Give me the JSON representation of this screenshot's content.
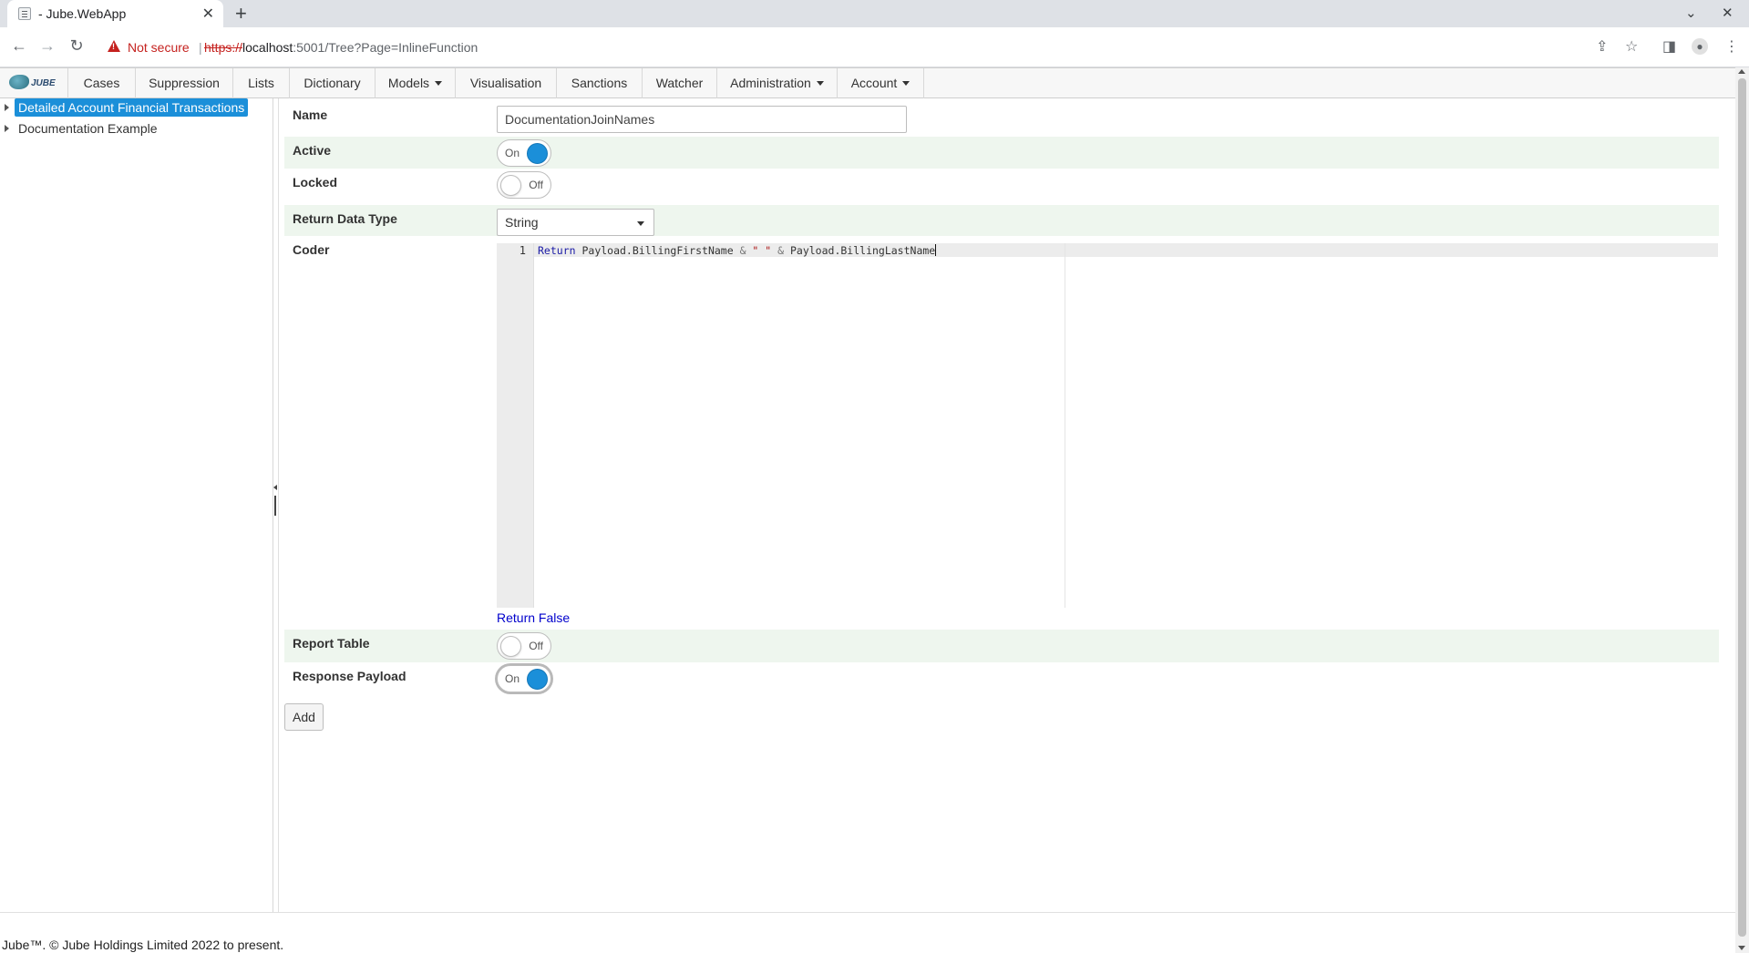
{
  "browser": {
    "tab_title": "- Jube.WebApp",
    "tab_close": "✕",
    "new_tab": "+",
    "not_secure": "Not secure",
    "url_scheme": "https://",
    "url_host": "localhost",
    "url_rest": ":5001/Tree?Page=InlineFunction"
  },
  "logo": {
    "text": "JUBE"
  },
  "nav": {
    "items": [
      {
        "label": "Cases"
      },
      {
        "label": "Suppression"
      },
      {
        "label": "Lists"
      },
      {
        "label": "Dictionary"
      },
      {
        "label": "Models"
      },
      {
        "label": "Visualisation"
      },
      {
        "label": "Sanctions"
      },
      {
        "label": "Watcher"
      },
      {
        "label": "Administration"
      },
      {
        "label": "Account"
      }
    ]
  },
  "tree": {
    "nodes": [
      {
        "label": "Detailed Account Financial Transactions",
        "selected": true
      },
      {
        "label": "Documentation Example",
        "selected": false
      }
    ]
  },
  "form": {
    "name": {
      "label": "Name",
      "value": "DocumentationJoinNames"
    },
    "active": {
      "label": "Active",
      "state": "On"
    },
    "locked": {
      "label": "Locked",
      "state": "Off"
    },
    "return_type": {
      "label": "Return Data Type",
      "value": "String"
    },
    "coder": {
      "label": "Coder",
      "line_number": "1",
      "code": {
        "kw": "Return",
        "part1": " Payload.BillingFirstName ",
        "op1": "&",
        "str": " \" \" ",
        "op2": "&",
        "part2": " Payload.BillingLastName"
      }
    },
    "return_false_link": "Return False",
    "report_table": {
      "label": "Report Table",
      "state": "Off"
    },
    "response_payload": {
      "label": "Response Payload",
      "state": "On"
    },
    "add_button": "Add"
  },
  "footer": {
    "text": "Jube™. © Jube Holdings Limited 2022 to present."
  },
  "colors": {
    "accent": "#1b8fd9",
    "row_alt": "#eef6ee",
    "link": "#0000cc"
  }
}
